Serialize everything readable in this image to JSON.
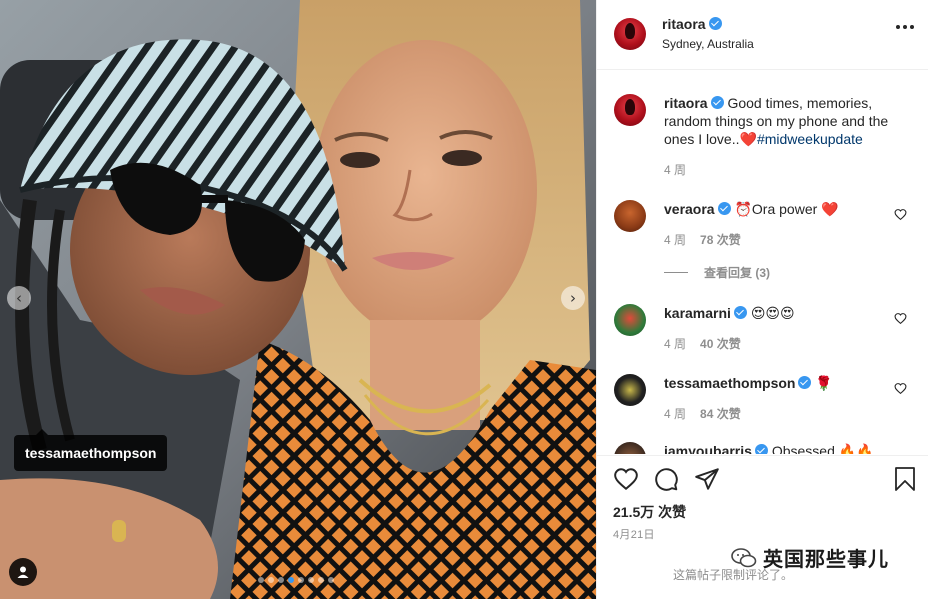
{
  "post": {
    "tag_label": "tessamaethompson",
    "carousel_count": 8,
    "carousel_active_index": 3
  },
  "header": {
    "username": "ritaora",
    "location": "Sydney, Australia"
  },
  "caption": {
    "username": "ritaora",
    "text": "Good times, memories, random things on my phone and the ones I love..",
    "emoji": "❤️",
    "hashtag": "#midweekupdate",
    "time": "4 周"
  },
  "comments": [
    {
      "username": "veraora",
      "text": "⏰Ora power ❤️",
      "time": "4 周",
      "likes": "78 次赞",
      "replies": "查看回复 (3)"
    },
    {
      "username": "karamarni",
      "text": "😍😍😍",
      "time": "4 周",
      "likes": "40 次赞"
    },
    {
      "username": "tessamaethompson",
      "text": "🌹",
      "time": "4 周",
      "likes": "84 次赞"
    },
    {
      "username": "iamyoubarris",
      "text": "Obsessed 🔥🔥"
    }
  ],
  "stats": {
    "likes": "21.5万 次赞",
    "date": "4月21日",
    "comments_off": "这篇帖子限制评论了。"
  },
  "watermark": {
    "text": "英国那些事儿"
  },
  "colors": {
    "verified": "#3897f0",
    "hashtag": "#00376b",
    "muted": "#8e8e8e",
    "text": "#262626"
  }
}
